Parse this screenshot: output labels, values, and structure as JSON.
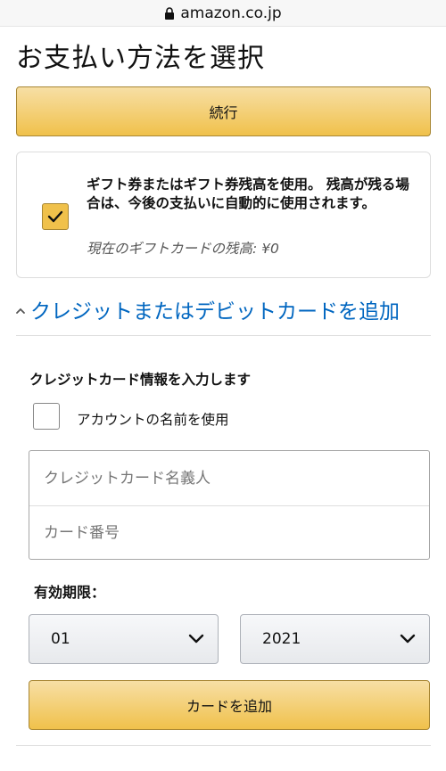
{
  "browser": {
    "domain": "amazon.co.jp"
  },
  "page": {
    "title": "お支払い方法を選択",
    "continue_label": "続行"
  },
  "gift": {
    "text": "ギフト券またはギフト券残高を使用。 残高が残る場合は、今後の支払いに自動的に使用されます。",
    "balance": "現在のギフトカードの残高: ¥0",
    "checked": true
  },
  "add_card_section": {
    "link_label": "クレジットまたはデビットカードを追加",
    "heading": "クレジットカード情報を入力します",
    "use_account_name_label": "アカウントの名前を使用",
    "cardholder_placeholder": "クレジットカード名義人",
    "card_number_placeholder": "カード番号",
    "expiry_label": "有効期限：",
    "month_value": "01",
    "year_value": "2021",
    "add_card_label": "カードを追加"
  },
  "colors": {
    "button_yellow": "#f0c14b",
    "link_blue": "#0066c0"
  },
  "icons": {
    "lock": "lock-icon",
    "checkmark": "checkmark-icon",
    "chevron_up": "chevron-up-icon",
    "chevron_down": "chevron-down-icon"
  }
}
